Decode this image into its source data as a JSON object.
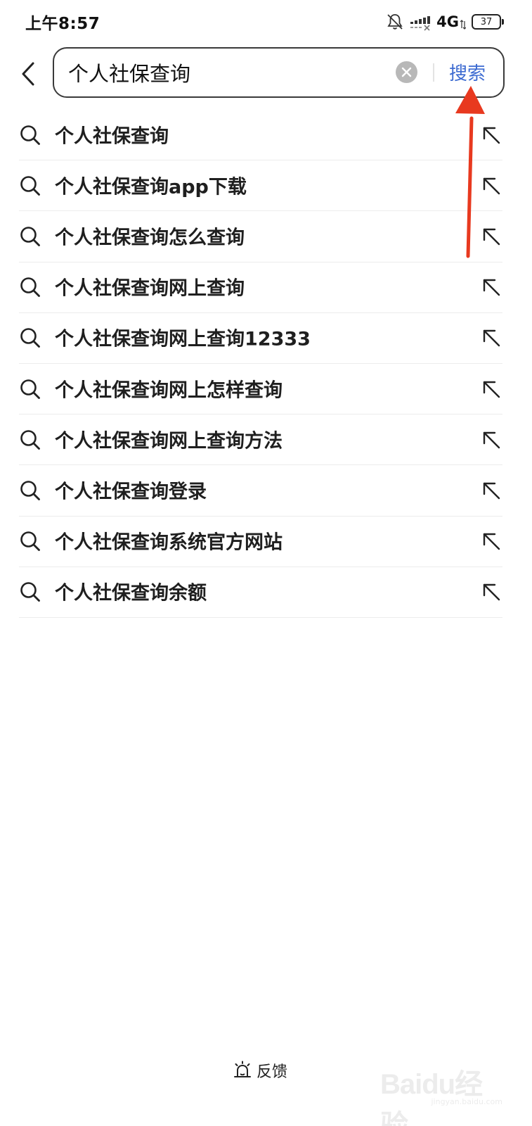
{
  "status_bar": {
    "time": "上午8:57",
    "network": "4G",
    "battery": "37"
  },
  "header": {
    "query": "个人社保查询",
    "search_label": "搜索"
  },
  "suggestions": [
    "个人社保查询",
    "个人社保查询app下载",
    "个人社保查询怎么查询",
    "个人社保查询网上查询",
    "个人社保查询网上查询12333",
    "个人社保查询网上怎样查询",
    "个人社保查询网上查询方法",
    "个人社保查询登录",
    "个人社保查询系统官方网站",
    "个人社保查询余额"
  ],
  "footer": {
    "feedback_label": "反馈"
  },
  "watermark": {
    "logo": "Baidu经验",
    "sub": "jingyan.baidu.com"
  },
  "colors": {
    "accent": "#3d6bd1",
    "annotation_arrow": "#e8391f"
  }
}
